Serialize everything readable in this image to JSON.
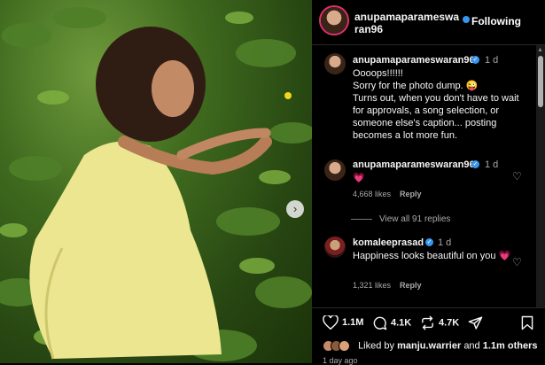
{
  "header": {
    "username": "anupamaparameswaran96",
    "follow_label": "Following"
  },
  "comments": [
    {
      "username": "anupamaparameswaran96",
      "time": "1 d",
      "lines": [
        "Oooops!!!!!!",
        "Sorry for the photo dump. 😜",
        "Turns out, when you don't have to wait",
        "for approvals, a song selection, or",
        "someone else's caption... posting",
        "becomes a lot more fun."
      ]
    },
    {
      "username": "anupamaparameswaran96",
      "time": "1 d",
      "text": "💗",
      "likes": "4,668 likes",
      "reply": "Reply"
    },
    {
      "username": "komaleeprasad",
      "time": "1 d",
      "text": "Happiness looks beautiful on you 💗",
      "likes": "1,321 likes",
      "reply": "Reply"
    }
  ],
  "view_replies": "View all 91 replies",
  "actions": {
    "likes": "1.1M",
    "comments": "4.1K",
    "shares": "4.7K"
  },
  "liked_by": {
    "prefix": "Liked by",
    "user": "manju.warrier",
    "and": "and",
    "others": "1.1m others"
  },
  "posted_ago": "1 day ago",
  "icons": [
    "heart-icon",
    "comment-icon",
    "repost-icon",
    "share-icon",
    "bookmark-icon",
    "verified-icon",
    "chevron-right-icon"
  ],
  "colors": {
    "accent": "#3797f0",
    "background": "#000000",
    "muted": "#a8a8a8"
  }
}
